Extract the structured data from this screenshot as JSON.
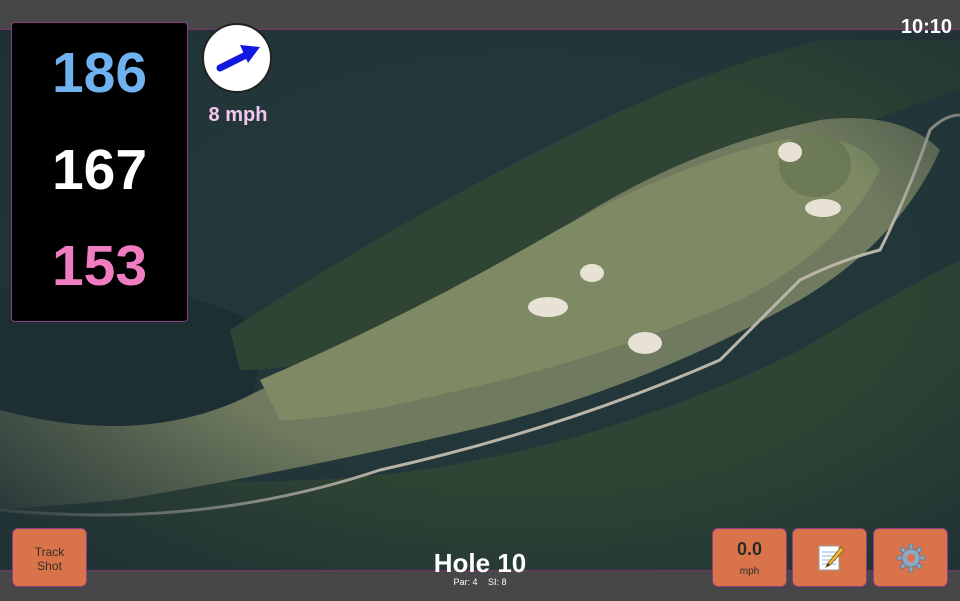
{
  "status_bar": {
    "time": "10:10"
  },
  "distances": {
    "back": "186",
    "center": "167",
    "front": "153"
  },
  "wind": {
    "speed": "8 mph",
    "direction_icon": "arrow-icon"
  },
  "buttons": {
    "track_shot_line1": "Track",
    "track_shot_line2": "Shot",
    "speed_value": "0.0",
    "speed_unit": "mph",
    "notes_icon": "notepad-icon",
    "settings_icon": "gear-icon"
  },
  "hole": {
    "title": "Hole 10",
    "par": "Par: 4",
    "stroke_index": "SI: 8"
  },
  "colors": {
    "back_distance": "#6fb2ef",
    "center_distance": "#ffffff",
    "front_distance": "#f07cc2",
    "button_bg": "#d9744a",
    "wind_text": "#f4c7ef"
  }
}
